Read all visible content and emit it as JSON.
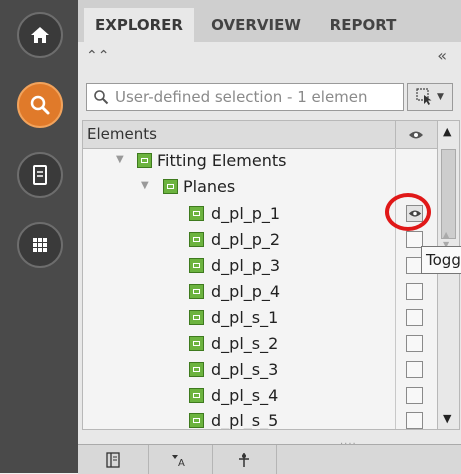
{
  "sidebar": {
    "buttons": [
      {
        "name": "home",
        "icon": "home-icon",
        "active": false
      },
      {
        "name": "search",
        "icon": "search-icon",
        "active": true
      },
      {
        "name": "document",
        "icon": "document-icon",
        "active": false
      },
      {
        "name": "grid",
        "icon": "grid-icon",
        "active": false
      }
    ]
  },
  "tabs": [
    "EXPLORER",
    "OVERVIEW",
    "REPORT"
  ],
  "collapse": {
    "up_icon": "double-chevron-up-icon",
    "left_label": "«"
  },
  "search": {
    "placeholder": "User-defined selection - 1 elemen"
  },
  "tree": {
    "column_header": "Elements",
    "visibility_header_icon": "eye-icon",
    "rows": [
      {
        "label": "Fitting Elements",
        "level": 0,
        "expander": "▼",
        "visible": null
      },
      {
        "label": "Planes",
        "level": 1,
        "expander": "▼",
        "visible": null
      },
      {
        "label": "d_pl_p_1",
        "level": 2,
        "visible": true
      },
      {
        "label": "d_pl_p_2",
        "level": 2,
        "visible": false
      },
      {
        "label": "d_pl_p_3",
        "level": 2,
        "visible": false
      },
      {
        "label": "d_pl_p_4",
        "level": 2,
        "visible": false
      },
      {
        "label": "d_pl_s_1",
        "level": 2,
        "visible": false
      },
      {
        "label": "d_pl_s_2",
        "level": 2,
        "visible": false
      },
      {
        "label": "d_pl_s_3",
        "level": 2,
        "visible": false
      },
      {
        "label": "d_pl_s_4",
        "level": 2,
        "visible": false
      },
      {
        "label": "d_pl_s_5",
        "level": 2,
        "visible": false
      }
    ]
  },
  "tooltip": {
    "text": "Togg"
  },
  "annotation": {
    "color": "#e01818"
  },
  "bottom_bar": {
    "grip": "....",
    "buttons": [
      "panel-icon",
      "filter-tool-icon",
      "pin-icon"
    ]
  },
  "colors": {
    "accent": "#e07a2a",
    "element_icon": "#6cb33f"
  }
}
